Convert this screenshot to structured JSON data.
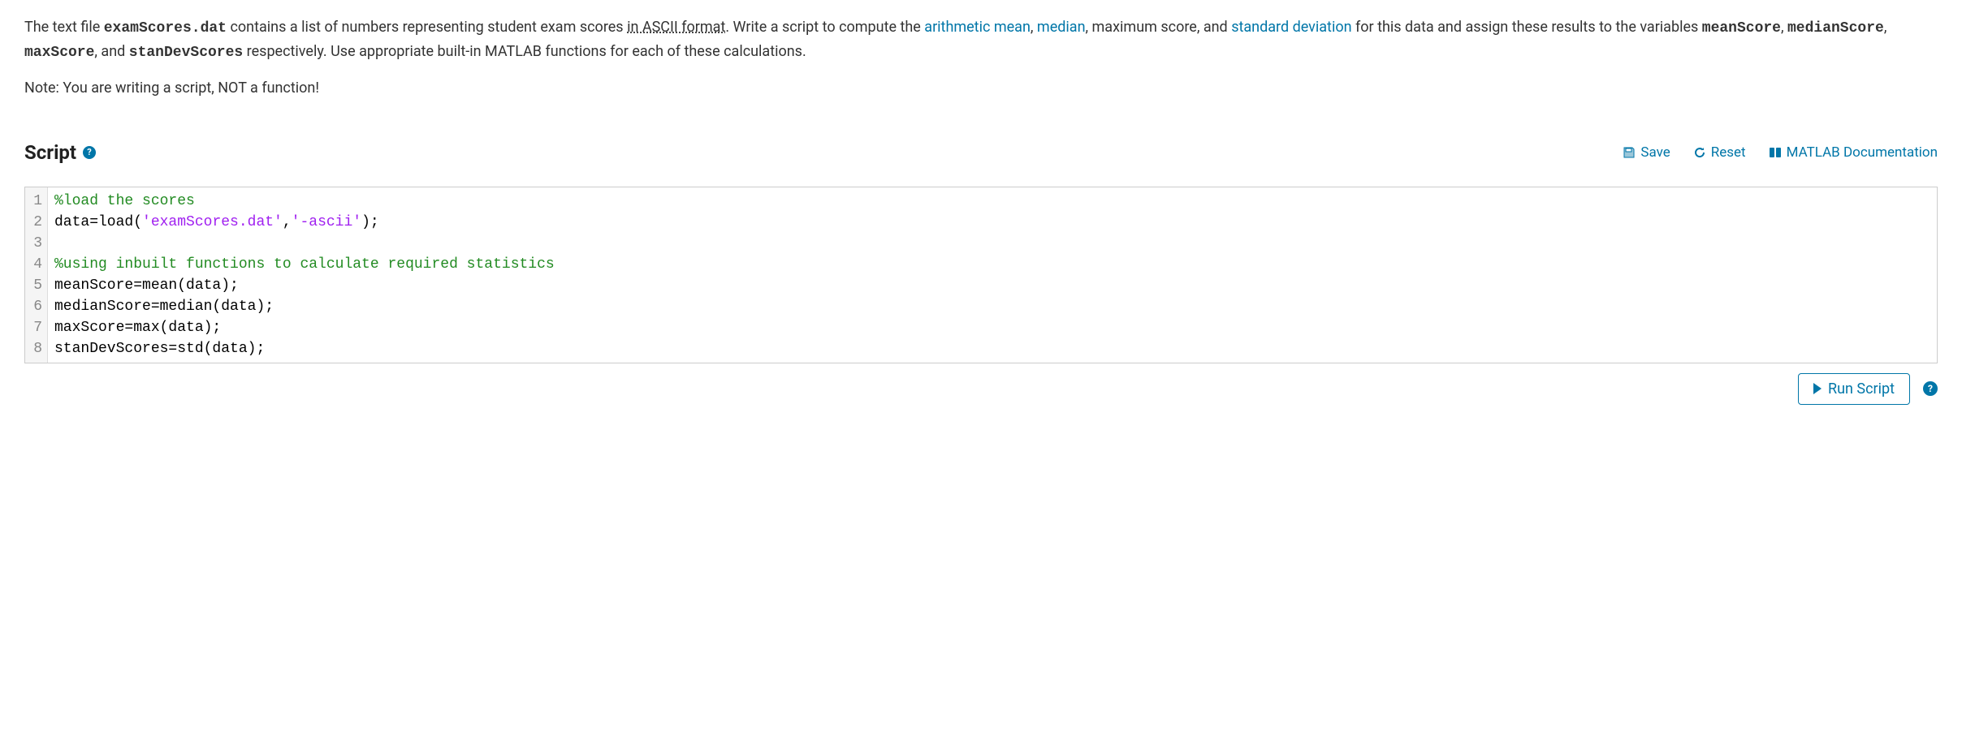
{
  "problem": {
    "pre1": "The text file ",
    "file": "examScores.dat",
    "post_file": " contains a list of numbers representing student exam scores ",
    "ascii": "in ASCII format",
    "post_ascii": ".  Write a script to compute the ",
    "link_mean": "arithmetic mean",
    "comma1": ", ",
    "link_median": "median",
    "post_median": ", maximum score, and ",
    "link_std": "standard deviation",
    "post_std": " for this data and assign these results to the variables ",
    "var1": "meanScore",
    "c2": ", ",
    "var2": "medianScore",
    "c3": ", ",
    "var3": "maxScore",
    "c4": ", and ",
    "var4": "stanDevScores",
    "tail": " respectively.  Use appropriate built-in MATLAB functions for each of these calculations."
  },
  "note": "Note: You are writing a script, NOT a function!",
  "header": {
    "title": "Script",
    "help": "?"
  },
  "toolbar": {
    "save": "Save",
    "reset": "Reset",
    "docs": "MATLAB Documentation"
  },
  "code": {
    "lines": [
      [
        {
          "t": "comment",
          "v": "%load the scores"
        }
      ],
      [
        {
          "t": "default",
          "v": "data=load("
        },
        {
          "t": "string",
          "v": "'examScores.dat'"
        },
        {
          "t": "default",
          "v": ","
        },
        {
          "t": "string",
          "v": "'-ascii'"
        },
        {
          "t": "default",
          "v": ");"
        }
      ],
      [],
      [
        {
          "t": "comment",
          "v": "%using inbuilt functions to calculate required statistics"
        }
      ],
      [
        {
          "t": "default",
          "v": "meanScore=mean(data);"
        }
      ],
      [
        {
          "t": "default",
          "v": "medianScore=median(data);"
        }
      ],
      [
        {
          "t": "default",
          "v": "maxScore=max(data);"
        }
      ],
      [
        {
          "t": "default",
          "v": "stanDevScores=std(data);"
        }
      ]
    ]
  },
  "footer": {
    "run": "Run Script",
    "help": "?"
  }
}
